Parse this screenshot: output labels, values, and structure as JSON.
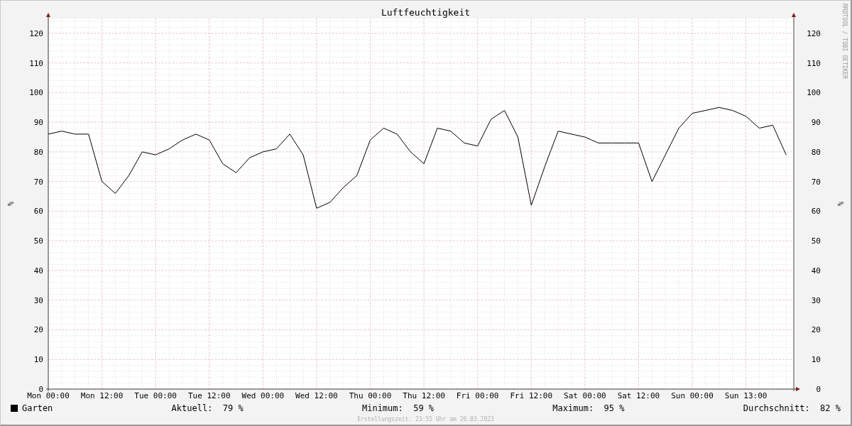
{
  "chart_data": {
    "type": "line",
    "title": "Luftfeuchtigkeit",
    "ylabel": "%",
    "categories": [
      "Mon 00:00",
      null,
      null,
      null,
      "Mon 12:00",
      null,
      null,
      null,
      "Tue 00:00",
      null,
      null,
      null,
      "Tue 12:00",
      null,
      null,
      null,
      "Wed 00:00",
      null,
      null,
      null,
      "Wed 12:00",
      null,
      null,
      null,
      "Thu 00:00",
      null,
      null,
      null,
      "Thu 12:00",
      null,
      null,
      null,
      "Fri 00:00",
      null,
      null,
      null,
      "Fri 12:00",
      null,
      null,
      null,
      "Sat 00:00",
      null,
      null,
      null,
      "Sat 12:00",
      null,
      null,
      null,
      "Sun 00:00",
      null,
      null,
      null,
      "Sun 13:00",
      null,
      null,
      null
    ],
    "series": [
      {
        "name": "Garten",
        "color": "#000000",
        "values": [
          86,
          87,
          86,
          86,
          70,
          66,
          72,
          80,
          79,
          81,
          84,
          86,
          84,
          76,
          73,
          78,
          80,
          81,
          86,
          79,
          61,
          63,
          68,
          72,
          84,
          88,
          86,
          80,
          76,
          88,
          87,
          83,
          82,
          91,
          94,
          85,
          62,
          75,
          87,
          86,
          85,
          83,
          83,
          83,
          83,
          70,
          79,
          88,
          93,
          94,
          95,
          94,
          92,
          88,
          89,
          79
        ]
      }
    ],
    "ylim": [
      0,
      125
    ],
    "grid": true,
    "yticks": [
      0,
      10,
      20,
      30,
      40,
      50,
      60,
      70,
      80,
      90,
      100,
      110,
      120
    ]
  },
  "right_axis": {
    "ylabel": "%",
    "ticks": [
      "120",
      "110",
      "100",
      "90",
      "80",
      "70",
      "60",
      "50",
      "40",
      "30",
      "20",
      "10",
      "0"
    ]
  },
  "side_text": "RRDTOOL / TOBI OETIKER",
  "legend": {
    "stats": [
      {
        "label": "Aktuell:",
        "value": "79 %"
      },
      {
        "label": "Minimum:",
        "value": "59 %"
      },
      {
        "label": "Maximum:",
        "value": "95 %"
      },
      {
        "label": "Durchschnitt:",
        "value": "82 %"
      }
    ]
  },
  "footer": "Erstellungszeit: 23:55 Uhr am 26.03.2023"
}
